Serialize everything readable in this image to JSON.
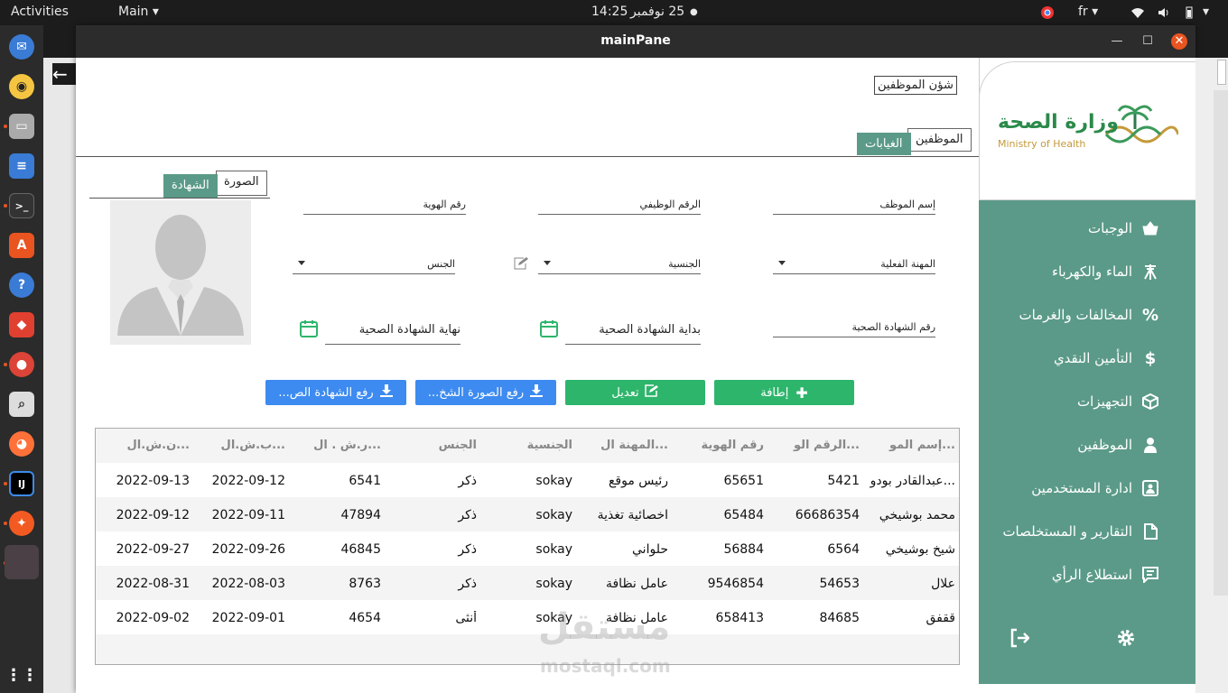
{
  "system_bar": {
    "activities": "Activities",
    "app_menu": "Main",
    "clock": "14:25",
    "date": "25 نوفمبر",
    "lang": "fr"
  },
  "window": {
    "title": "mainPane"
  },
  "page": {
    "section_title": "شؤن الموظفين",
    "tabs": [
      "الموظفين",
      "الغيابات"
    ],
    "photo_tabs": [
      "الصورة",
      "الشهادة"
    ]
  },
  "sidebar": {
    "logo_ar": "وزارة الصحة",
    "logo_en": "Ministry of Health",
    "items": [
      {
        "label": "الوجبات",
        "icon": "basket-icon"
      },
      {
        "label": "الماء والكهرباء",
        "icon": "power-tower-icon"
      },
      {
        "label": "المخالفات والغرمات",
        "icon": "percent-icon"
      },
      {
        "label": "التأمين النقدي",
        "icon": "dollar-icon"
      },
      {
        "label": "التجهيزات",
        "icon": "box-icon"
      },
      {
        "label": "الموظفين",
        "icon": "employee-icon"
      },
      {
        "label": "ادارة المستخدمين",
        "icon": "user-card-icon"
      },
      {
        "label": "التقارير و المستخلصات",
        "icon": "document-icon"
      },
      {
        "label": "استطلاع الرأي",
        "icon": "comment-icon"
      }
    ]
  },
  "form": {
    "employee_name": "إسم الموظف",
    "job_number": "الرقم الوظيفي",
    "id_number": "رقم الهوية",
    "actual_job": "المهنة الفعلية",
    "nationality": "الجنسية",
    "gender": "الجنس",
    "cert_number": "رقم الشهادة الصحية",
    "cert_start": "بداية الشهادة الصحية",
    "cert_end": "نهاية الشهادة الصحية"
  },
  "buttons": {
    "add": "إطافة",
    "edit": "تعديل",
    "upload_photo": "رفع الصورة الشخ...",
    "upload_cert": "رفع الشهادة الص..."
  },
  "table": {
    "headers": [
      "إسم المو...",
      "الرقم الو...",
      "رقم الهوية",
      "المهنة ال...",
      "الجنسية",
      "الجنس",
      "ر.ش . ال...",
      "ب.ش.ال...",
      "ن.ش.ال..."
    ],
    "rows": [
      [
        "عبدالقادر بودو...",
        "5421",
        "65651",
        "رئيس موقع",
        "sokay",
        "ذكر",
        "6541",
        "2022-09-12",
        "2022-09-13"
      ],
      [
        "محمد بوشيخي",
        "66686354",
        "65484",
        "اخصائية تغذية",
        "sokay",
        "ذكر",
        "47894",
        "2022-09-11",
        "2022-09-12"
      ],
      [
        "شيخ بوشيخي",
        "6564",
        "56884",
        "حلواني",
        "sokay",
        "ذكر",
        "46845",
        "2022-09-26",
        "2022-09-27"
      ],
      [
        "علال",
        "54653",
        "9546854",
        "عامل نظافة",
        "sokay",
        "ذكر",
        "8763",
        "2022-08-03",
        "2022-08-31"
      ],
      [
        "ققفق",
        "84685",
        "658413",
        "عامل نظافة",
        "sokay",
        "أنثى",
        "4654",
        "2022-09-01",
        "2022-09-02"
      ]
    ]
  },
  "watermark": {
    "ar": "مستقل",
    "en": "mostaql.com"
  },
  "colors": {
    "accent": "#5b9a88",
    "green_button": "#2eb56c",
    "blue_button": "#3d8bf0",
    "close_button": "#e95420"
  }
}
